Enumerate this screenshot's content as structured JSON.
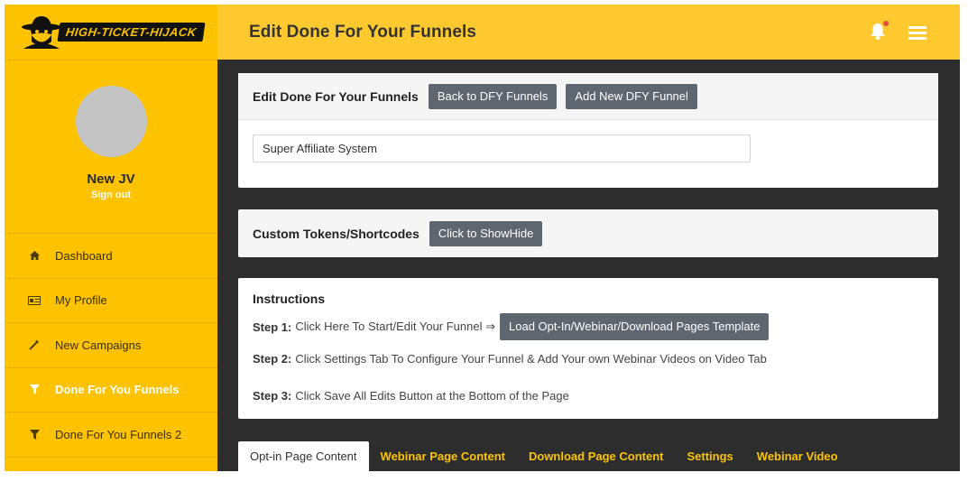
{
  "brand": {
    "logo_text": "HIGH-TICKET-HIJACK"
  },
  "header": {
    "title": "Edit Done For Your Funnels"
  },
  "profile": {
    "name": "New JV",
    "signout": "Sign out"
  },
  "sidebar": {
    "items": [
      {
        "label": "Dashboard",
        "icon": "home-icon"
      },
      {
        "label": "My Profile",
        "icon": "id-card-icon"
      },
      {
        "label": "New Campaigns",
        "icon": "magic-wand-icon"
      },
      {
        "label": "Done For You Funnels",
        "icon": "funnel-icon",
        "active": true
      },
      {
        "label": "Done For You Funnels 2",
        "icon": "funnel-icon"
      }
    ]
  },
  "edit_panel": {
    "title": "Edit Done For Your Funnels",
    "back_button": "Back to DFY Funnels",
    "add_button": "Add New DFY Funnel",
    "funnel_name_value": "Super Affiliate System"
  },
  "tokens_panel": {
    "title": "Custom Tokens/Shortcodes",
    "toggle_button": "Click to ShowHide"
  },
  "instructions": {
    "title": "Instructions",
    "step1_label": "Step 1:",
    "step1_text": "Click Here To Start/Edit Your Funnel ⇒",
    "step1_button": "Load Opt-In/Webinar/Download Pages Template",
    "step2_label": "Step 2:",
    "step2_text": "Click Settings Tab To Configure Your Funnel & Add Your own Webinar Videos on Video Tab",
    "step3_label": "Step 3:",
    "step3_text": "Click Save All Edits Button at the Bottom of the Page"
  },
  "tabs": [
    {
      "label": "Opt-in Page Content",
      "active": true
    },
    {
      "label": "Webinar Page Content"
    },
    {
      "label": "Download Page Content"
    },
    {
      "label": "Settings"
    },
    {
      "label": "Webinar Video"
    }
  ],
  "colors": {
    "sidebar": "#fdc200",
    "header": "#fdc92f",
    "main_bg": "#2d2d2d",
    "button": "#5e6670",
    "notify_dot": "#e74c3c"
  }
}
